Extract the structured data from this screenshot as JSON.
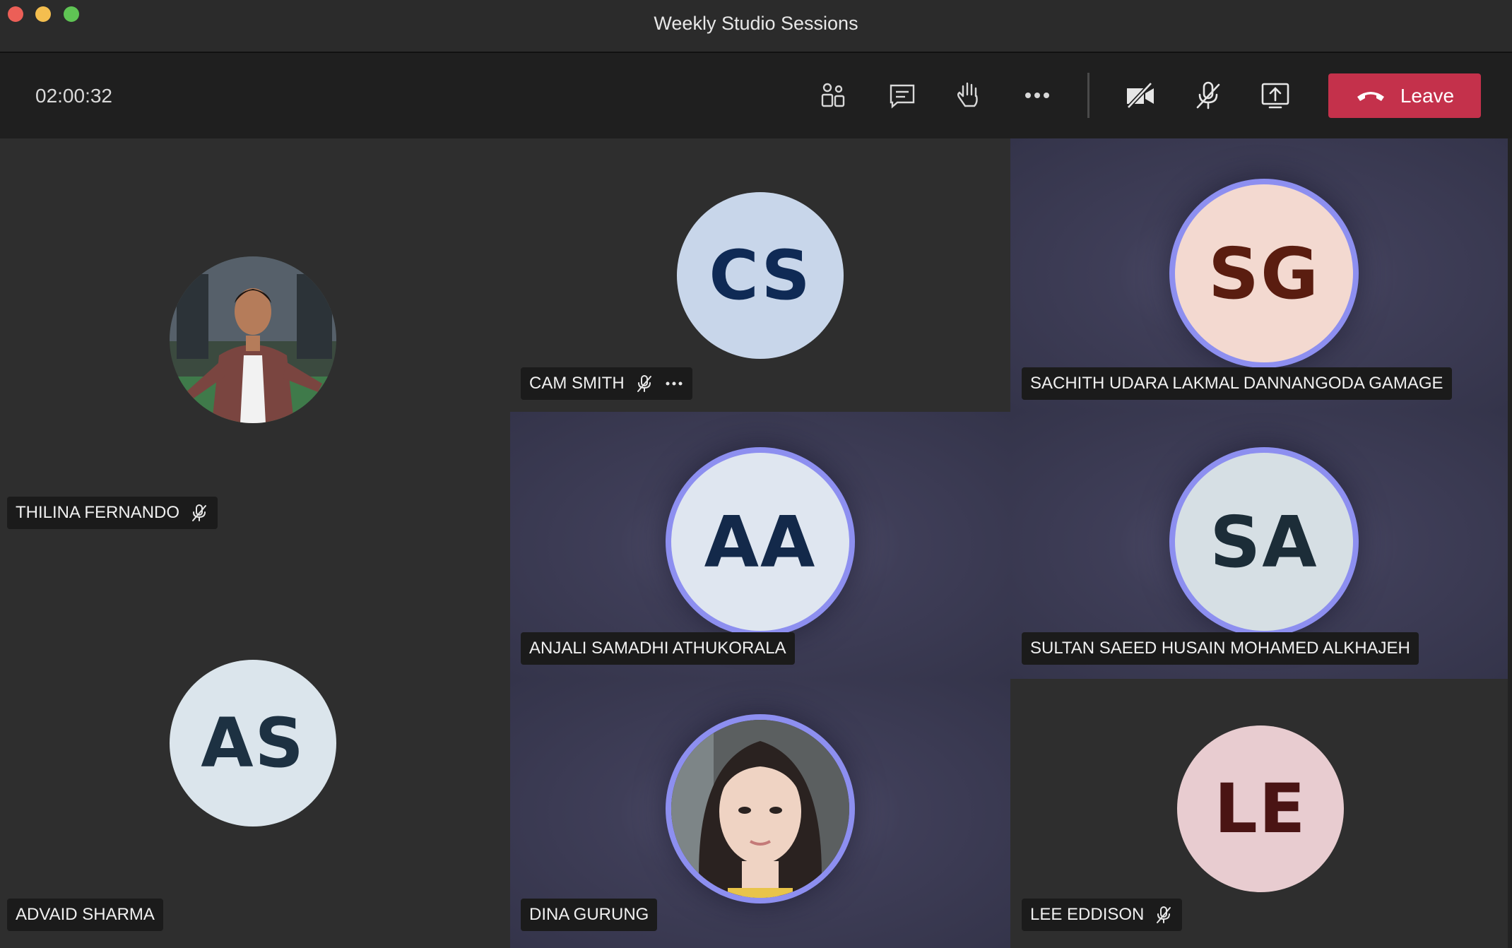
{
  "window": {
    "title": "Weekly Studio Sessions"
  },
  "toolbar": {
    "timer": "02:00:32",
    "buttons": [
      {
        "name": "participants",
        "icon": "people-icon"
      },
      {
        "name": "chat",
        "icon": "chat-icon"
      },
      {
        "name": "raise-hand",
        "icon": "hand-icon"
      },
      {
        "name": "more",
        "icon": "more-icon"
      },
      {
        "name": "camera",
        "icon": "camera-off-icon"
      },
      {
        "name": "mic",
        "icon": "mic-off-icon"
      },
      {
        "name": "share",
        "icon": "share-screen-icon"
      }
    ],
    "leave_label": "Leave"
  },
  "colors": {
    "leave": "#c4314b",
    "speaking_ring": "#8d8ff0",
    "tile_bg": "#2e2e2e",
    "active_tile_bg": "#3f3e58"
  },
  "participants": [
    {
      "name": "THILINA FERNANDO",
      "initials": "",
      "has_photo": true,
      "muted": true
    },
    {
      "name": "CAM SMITH",
      "initials": "CS",
      "muted": true,
      "has_more": true,
      "avatar_bg": "#c8d6ea",
      "avatar_fg": "#0f2a55"
    },
    {
      "name": "SACHITH UDARA LAKMAL DANNANGODA GAMAGE",
      "initials": "SG",
      "speaking": true,
      "avatar_bg": "#f3d9d0",
      "avatar_fg": "#5a1d10"
    },
    {
      "name": "ANJALI SAMADHI ATHUKORALA",
      "initials": "AA",
      "speaking": true,
      "avatar_bg": "#dfe6f0",
      "avatar_fg": "#13294a"
    },
    {
      "name": "SULTAN SAEED HUSAIN MOHAMED ALKHAJEH",
      "initials": "SA",
      "speaking": true,
      "avatar_bg": "#d6dfe4",
      "avatar_fg": "#1c2d38"
    },
    {
      "name": "ADVAID SHARMA",
      "initials": "AS",
      "avatar_bg": "#dbe5ec",
      "avatar_fg": "#1d3142"
    },
    {
      "name": "DINA GURUNG",
      "initials": "",
      "has_photo": true,
      "speaking": true
    },
    {
      "name": "LEE EDDISON",
      "initials": "LE",
      "muted": true,
      "avatar_bg": "#e8ccd0",
      "avatar_fg": "#4a1414"
    }
  ]
}
